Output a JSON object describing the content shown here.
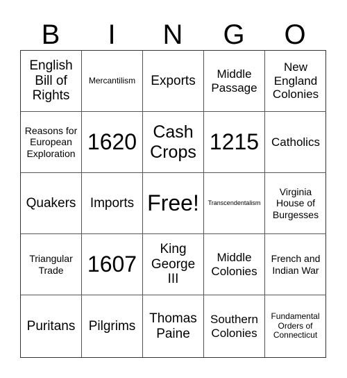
{
  "header": {
    "letters": [
      "B",
      "I",
      "N",
      "G",
      "O"
    ]
  },
  "grid": {
    "rows": [
      [
        "English Bill of Rights",
        "Mercantilism",
        "Exports",
        "Middle Passage",
        "New England Colonies"
      ],
      [
        "Reasons for European Exploration",
        "1620",
        "Cash Crops",
        "1215",
        "Catholics"
      ],
      [
        "Quakers",
        "Imports",
        "Free!",
        "Transcendentalism",
        "Virginia House of Burgesses"
      ],
      [
        "Triangular Trade",
        "1607",
        "King George III",
        "Middle Colonies",
        "French and Indian War"
      ],
      [
        "Puritans",
        "Pilgrims",
        "Thomas Paine",
        "Southern Colonies",
        "Fundamental Orders of Connecticut"
      ]
    ]
  }
}
